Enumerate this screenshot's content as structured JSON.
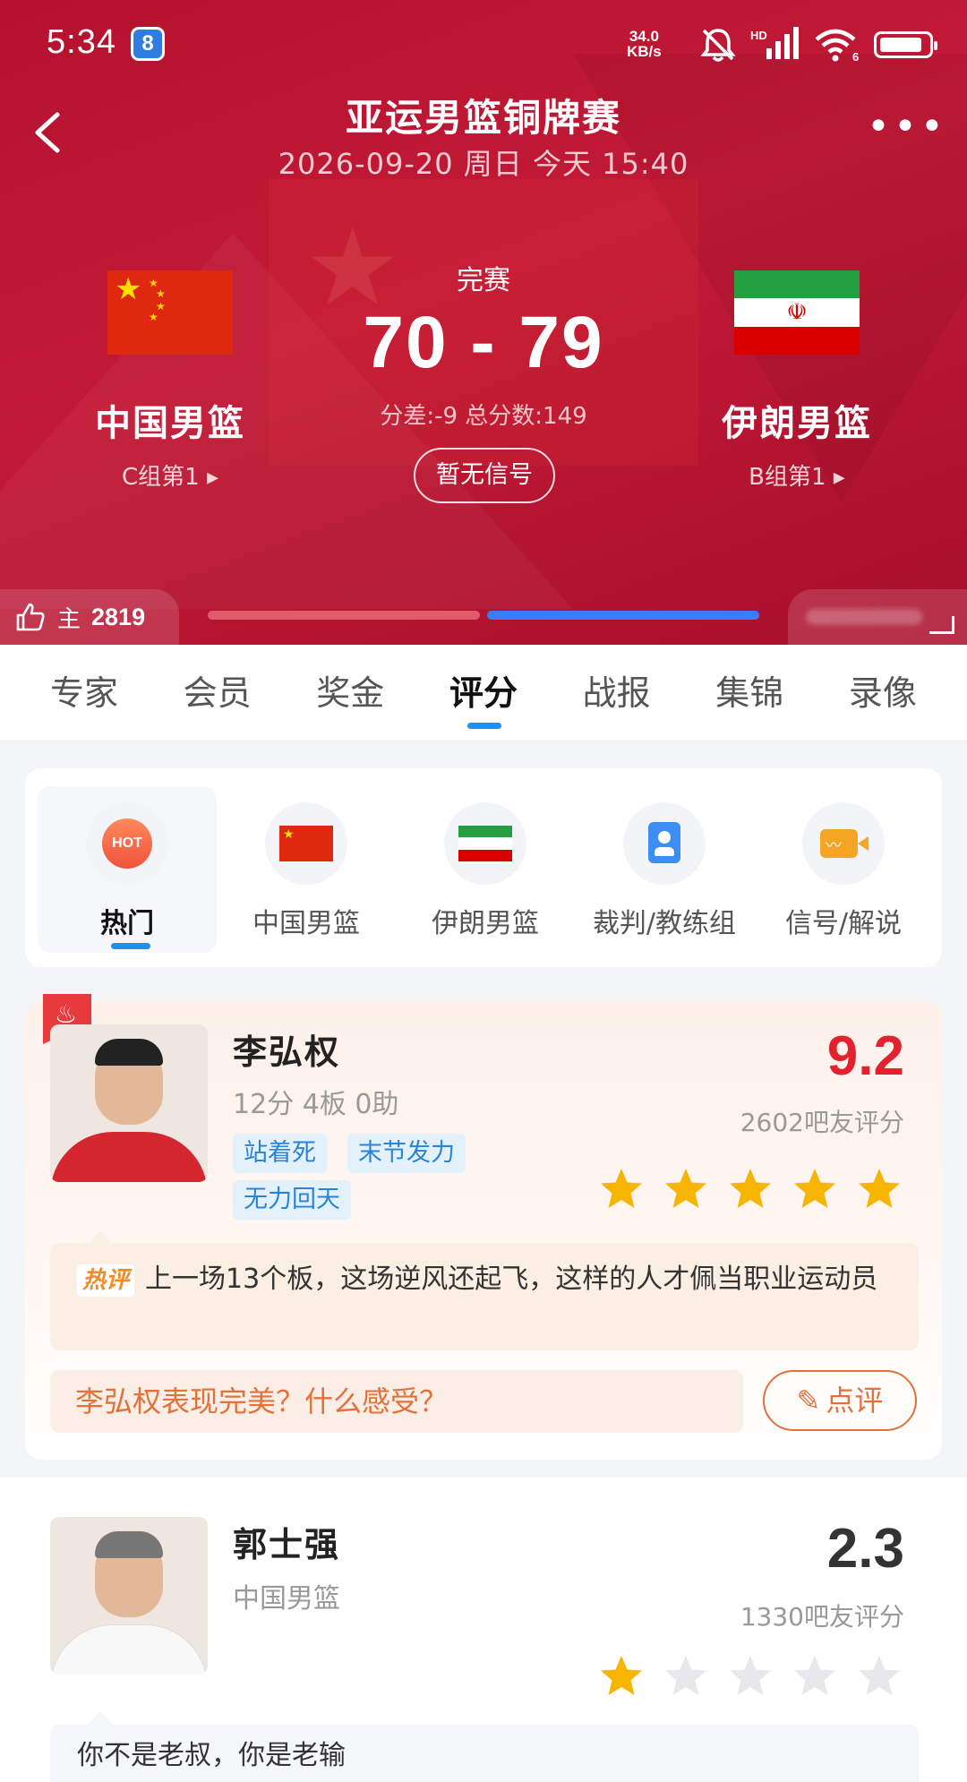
{
  "status_bar": {
    "time": "5:34",
    "badge": "8",
    "net_speed_value": "34.0",
    "net_speed_unit": "KB/s",
    "signal_label": "HD",
    "wifi_label": "6",
    "battery_level": 0.85,
    "icons": [
      "mute-icon",
      "signal-icon",
      "wifi-icon",
      "battery-icon"
    ]
  },
  "header": {
    "title": "亚运男篮铜牌赛",
    "date": "2026-09-20 周日 今天 15:40",
    "back_icon": "chevron-left-icon",
    "more_icon": "more-dots-icon"
  },
  "match": {
    "status": "完赛",
    "score": "70 - 79",
    "meta": "分差:-9 总分数:149",
    "signal_button": "暂无信号",
    "home": {
      "name": "中国男篮",
      "group": "C组第1 ▸",
      "flag": "china-flag"
    },
    "away": {
      "name": "伊朗男篮",
      "group": "B组第1 ▸",
      "flag": "iran-flag"
    }
  },
  "support": {
    "label": "主",
    "home_count": "2819",
    "home_share": 0.5,
    "colors": {
      "home": "#e05c6a",
      "away": "#3b7cff"
    }
  },
  "tabs": [
    {
      "label": "专家",
      "active": false
    },
    {
      "label": "会员",
      "active": false
    },
    {
      "label": "奖金",
      "active": false
    },
    {
      "label": "评分",
      "active": true
    },
    {
      "label": "战报",
      "active": false
    },
    {
      "label": "集锦",
      "active": false
    },
    {
      "label": "录像",
      "active": false
    }
  ],
  "categories": [
    {
      "label": "热门",
      "icon": "hot-icon",
      "icon_text": "HOT",
      "active": true
    },
    {
      "label": "中国男篮",
      "icon": "china-flag-icon",
      "active": false
    },
    {
      "label": "伊朗男篮",
      "icon": "iran-flag-icon",
      "active": false
    },
    {
      "label": "裁判/教练组",
      "icon": "referee-icon",
      "active": false
    },
    {
      "label": "信号/解说",
      "icon": "video-signal-icon",
      "active": false
    }
  ],
  "players": [
    {
      "name": "李弘权",
      "stats": "12分 4板 0助",
      "tags": [
        "站着死",
        "末节发力",
        "无力回天"
      ],
      "rating": "9.2",
      "rating_color": "#e2222f",
      "rating_count": "2602吧友评分",
      "stars": 5,
      "hot_comment_label": "热评",
      "hot_comment": "上一场13个板，这场逆风还起飞，这样的人才佩当职业运动员",
      "prompt": "李弘权表现完美？什么感受？",
      "review_button": "点评"
    },
    {
      "name": "郭士强",
      "stats": "中国男篮",
      "rating": "2.3",
      "rating_color": "#333333",
      "rating_count": "1330吧友评分",
      "stars": 1,
      "comment": "你不是老叔，你是老输"
    }
  ]
}
